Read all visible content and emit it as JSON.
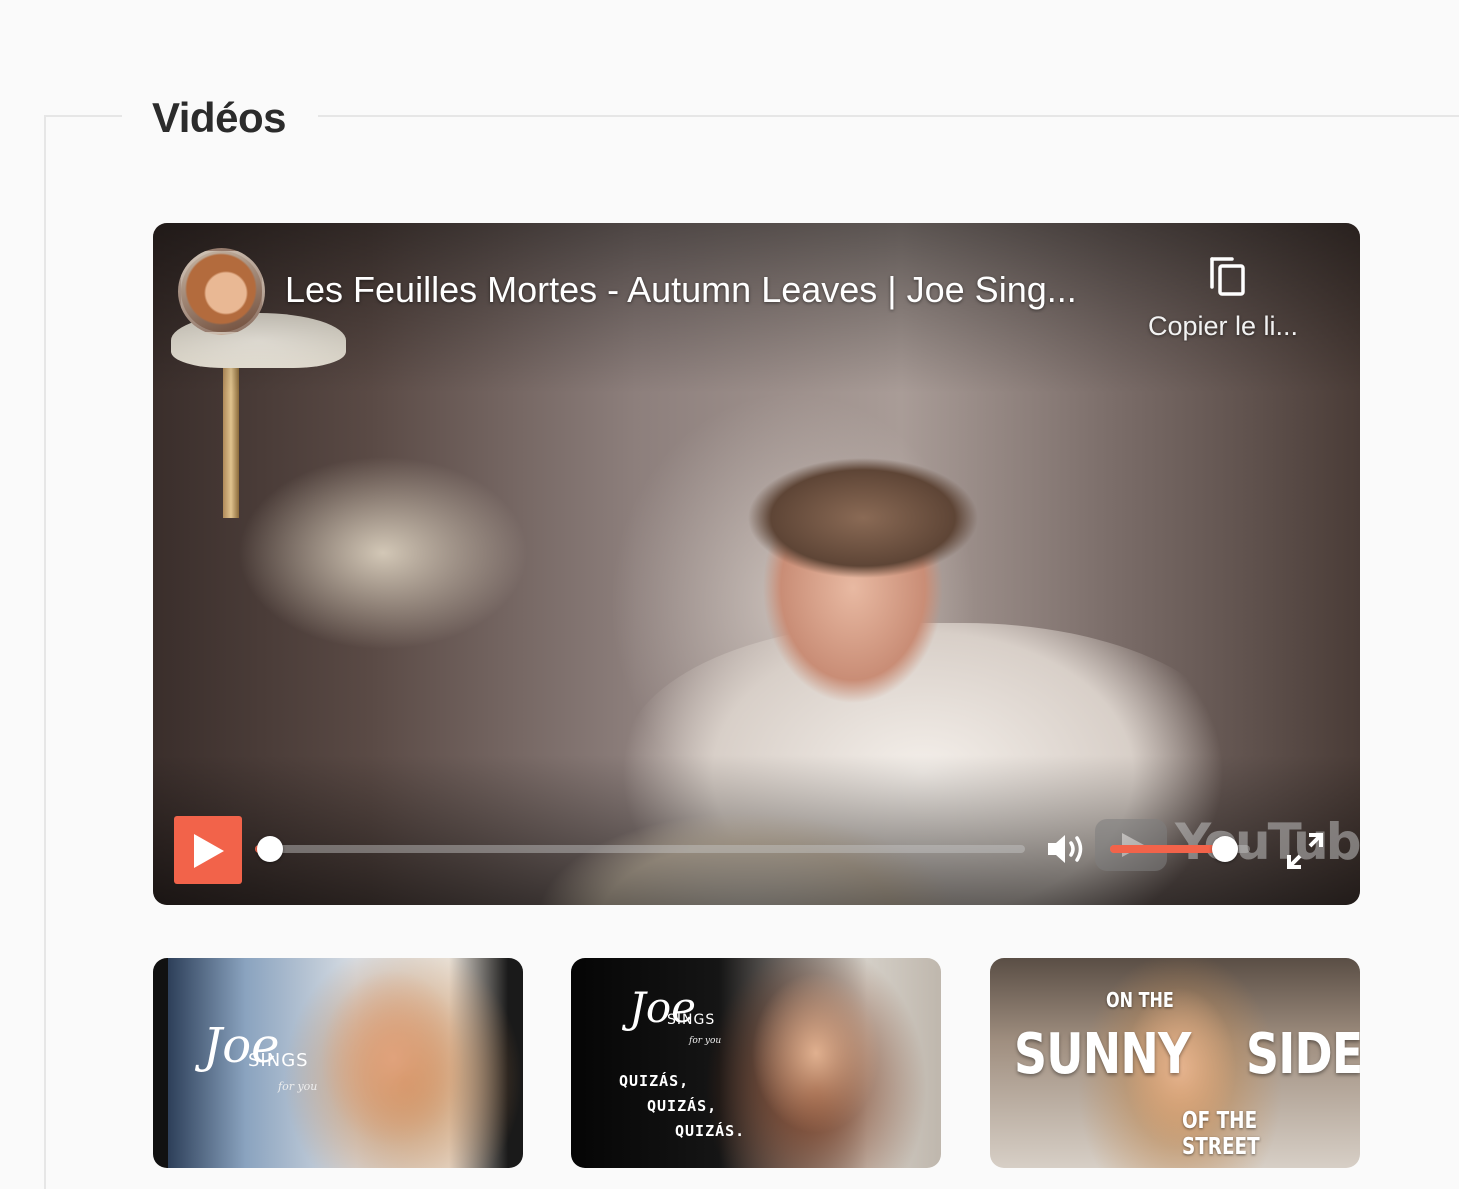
{
  "section": {
    "title": "Vidéos"
  },
  "player": {
    "title": "Les Feuilles Mortes - Autumn Leaves | Joe Sing...",
    "copy_label": "Copier le li...",
    "progress_fraction": 0.02,
    "volume_fraction": 0.82,
    "accent_color": "#f2634a",
    "icons": {
      "play": "play-icon",
      "volume": "volume-icon",
      "fullscreen": "fullscreen-icon",
      "copy": "copy-icon",
      "logo": "youtube-logo"
    },
    "logo_text": "YouTube"
  },
  "thumbnails": [
    {
      "script": "Joe",
      "sings": "SINGS",
      "tagline": "for you"
    },
    {
      "script": "Joe",
      "sings": "SINGS",
      "tagline": "for you",
      "lines": [
        "QUIZÁS,",
        "QUIZÁS,",
        "QUIZÁS."
      ]
    },
    {
      "top": "ON THE",
      "left_word": "SUNNY",
      "right_word": "SIDE",
      "bottom": "OF THE STREET"
    }
  ]
}
